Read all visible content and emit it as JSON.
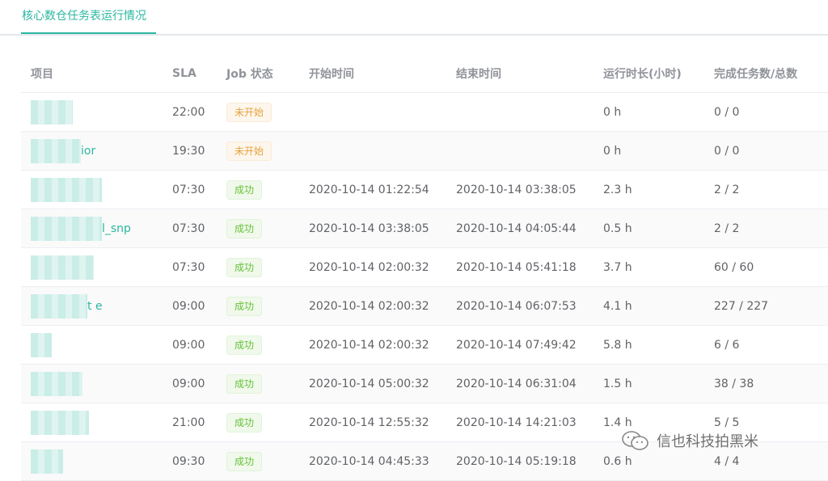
{
  "tab": {
    "title": "核心数仓任务表运行情况"
  },
  "columns": [
    "项目",
    "SLA",
    "Job 状态",
    "开始时间",
    "结束时间",
    "运行时长(小时)",
    "完成任务数/总数"
  ],
  "rows": [
    {
      "project": "",
      "sla": "22:00",
      "status": "未开始",
      "start": "",
      "end": "",
      "duration": "0 h",
      "tasks": "0 / 0"
    },
    {
      "project": "ior",
      "sla": "19:30",
      "status": "未开始",
      "start": "",
      "end": "",
      "duration": "0 h",
      "tasks": "0 / 0"
    },
    {
      "project": "",
      "sla": "07:30",
      "status": "成功",
      "start": "2020-10-14 01:22:54",
      "end": "2020-10-14 03:38:05",
      "duration": "2.3 h",
      "tasks": "2 / 2"
    },
    {
      "project": "l_snp",
      "sla": "07:30",
      "status": "成功",
      "start": "2020-10-14 03:38:05",
      "end": "2020-10-14 04:05:44",
      "duration": "0.5 h",
      "tasks": "2 / 2"
    },
    {
      "project": "",
      "sla": "07:30",
      "status": "成功",
      "start": "2020-10-14 02:00:32",
      "end": "2020-10-14 05:41:18",
      "duration": "3.7 h",
      "tasks": "60 / 60"
    },
    {
      "project": "t e",
      "sla": "09:00",
      "status": "成功",
      "start": "2020-10-14 02:00:32",
      "end": "2020-10-14 06:07:53",
      "duration": "4.1 h",
      "tasks": "227 / 227"
    },
    {
      "project": "",
      "sla": "09:00",
      "status": "成功",
      "start": "2020-10-14 02:00:32",
      "end": "2020-10-14 07:49:42",
      "duration": "5.8 h",
      "tasks": "6 / 6"
    },
    {
      "project": "",
      "sla": "09:00",
      "status": "成功",
      "start": "2020-10-14 05:00:32",
      "end": "2020-10-14 06:31:04",
      "duration": "1.5 h",
      "tasks": "38 / 38"
    },
    {
      "project": "",
      "sla": "21:00",
      "status": "成功",
      "start": "2020-10-14 12:55:32",
      "end": "2020-10-14 14:21:03",
      "duration": "1.4 h",
      "tasks": "5 / 5"
    },
    {
      "project": "",
      "sla": "09:30",
      "status": "成功",
      "start": "2020-10-14 04:45:33",
      "end": "2020-10-14 05:19:18",
      "duration": "0.6 h",
      "tasks": "4 / 4"
    }
  ],
  "watermark": {
    "text": "信也科技拍黑米",
    "icon": "wechat-icon"
  },
  "colors": {
    "accent": "#2bb7a0",
    "pending": "#e6a23c",
    "success": "#67c23a"
  }
}
